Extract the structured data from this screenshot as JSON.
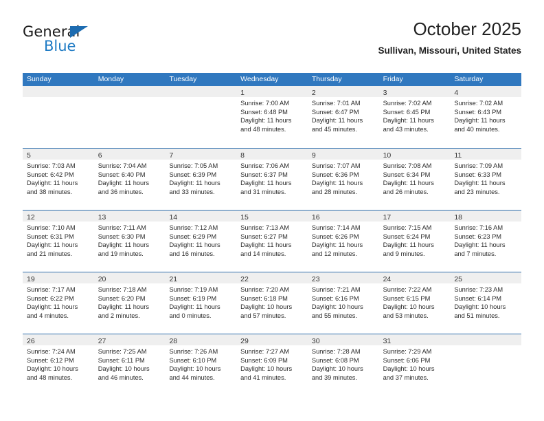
{
  "branding": {
    "logo_text_primary": "General",
    "logo_text_secondary": "Blue",
    "logo_triangle_color": "#1d6cb1",
    "logo_secondary_color": "#1d7ac4"
  },
  "header": {
    "title": "October 2025",
    "subtitle": "Sullivan, Missouri, United States"
  },
  "theme": {
    "header_bar_color": "#3078bf",
    "row_divider_color": "#2f6fad",
    "day_band_color": "#efefef",
    "text_color": "#2a2a2a"
  },
  "weekdays": [
    "Sunday",
    "Monday",
    "Tuesday",
    "Wednesday",
    "Thursday",
    "Friday",
    "Saturday"
  ],
  "labels": {
    "sunrise_prefix": "Sunrise:",
    "sunset_prefix": "Sunset:",
    "daylight_prefix": "Daylight:"
  },
  "weeks": [
    [
      {
        "date": "",
        "empty": true
      },
      {
        "date": "",
        "empty": true
      },
      {
        "date": "",
        "empty": true
      },
      {
        "date": "1",
        "sunrise": "Sunrise: 7:00 AM",
        "sunset": "Sunset: 6:48 PM",
        "daylight": "Daylight: 11 hours and 48 minutes."
      },
      {
        "date": "2",
        "sunrise": "Sunrise: 7:01 AM",
        "sunset": "Sunset: 6:47 PM",
        "daylight": "Daylight: 11 hours and 45 minutes."
      },
      {
        "date": "3",
        "sunrise": "Sunrise: 7:02 AM",
        "sunset": "Sunset: 6:45 PM",
        "daylight": "Daylight: 11 hours and 43 minutes."
      },
      {
        "date": "4",
        "sunrise": "Sunrise: 7:02 AM",
        "sunset": "Sunset: 6:43 PM",
        "daylight": "Daylight: 11 hours and 40 minutes."
      }
    ],
    [
      {
        "date": "5",
        "sunrise": "Sunrise: 7:03 AM",
        "sunset": "Sunset: 6:42 PM",
        "daylight": "Daylight: 11 hours and 38 minutes."
      },
      {
        "date": "6",
        "sunrise": "Sunrise: 7:04 AM",
        "sunset": "Sunset: 6:40 PM",
        "daylight": "Daylight: 11 hours and 36 minutes."
      },
      {
        "date": "7",
        "sunrise": "Sunrise: 7:05 AM",
        "sunset": "Sunset: 6:39 PM",
        "daylight": "Daylight: 11 hours and 33 minutes."
      },
      {
        "date": "8",
        "sunrise": "Sunrise: 7:06 AM",
        "sunset": "Sunset: 6:37 PM",
        "daylight": "Daylight: 11 hours and 31 minutes."
      },
      {
        "date": "9",
        "sunrise": "Sunrise: 7:07 AM",
        "sunset": "Sunset: 6:36 PM",
        "daylight": "Daylight: 11 hours and 28 minutes."
      },
      {
        "date": "10",
        "sunrise": "Sunrise: 7:08 AM",
        "sunset": "Sunset: 6:34 PM",
        "daylight": "Daylight: 11 hours and 26 minutes."
      },
      {
        "date": "11",
        "sunrise": "Sunrise: 7:09 AM",
        "sunset": "Sunset: 6:33 PM",
        "daylight": "Daylight: 11 hours and 23 minutes."
      }
    ],
    [
      {
        "date": "12",
        "sunrise": "Sunrise: 7:10 AM",
        "sunset": "Sunset: 6:31 PM",
        "daylight": "Daylight: 11 hours and 21 minutes."
      },
      {
        "date": "13",
        "sunrise": "Sunrise: 7:11 AM",
        "sunset": "Sunset: 6:30 PM",
        "daylight": "Daylight: 11 hours and 19 minutes."
      },
      {
        "date": "14",
        "sunrise": "Sunrise: 7:12 AM",
        "sunset": "Sunset: 6:29 PM",
        "daylight": "Daylight: 11 hours and 16 minutes."
      },
      {
        "date": "15",
        "sunrise": "Sunrise: 7:13 AM",
        "sunset": "Sunset: 6:27 PM",
        "daylight": "Daylight: 11 hours and 14 minutes."
      },
      {
        "date": "16",
        "sunrise": "Sunrise: 7:14 AM",
        "sunset": "Sunset: 6:26 PM",
        "daylight": "Daylight: 11 hours and 12 minutes."
      },
      {
        "date": "17",
        "sunrise": "Sunrise: 7:15 AM",
        "sunset": "Sunset: 6:24 PM",
        "daylight": "Daylight: 11 hours and 9 minutes."
      },
      {
        "date": "18",
        "sunrise": "Sunrise: 7:16 AM",
        "sunset": "Sunset: 6:23 PM",
        "daylight": "Daylight: 11 hours and 7 minutes."
      }
    ],
    [
      {
        "date": "19",
        "sunrise": "Sunrise: 7:17 AM",
        "sunset": "Sunset: 6:22 PM",
        "daylight": "Daylight: 11 hours and 4 minutes."
      },
      {
        "date": "20",
        "sunrise": "Sunrise: 7:18 AM",
        "sunset": "Sunset: 6:20 PM",
        "daylight": "Daylight: 11 hours and 2 minutes."
      },
      {
        "date": "21",
        "sunrise": "Sunrise: 7:19 AM",
        "sunset": "Sunset: 6:19 PM",
        "daylight": "Daylight: 11 hours and 0 minutes."
      },
      {
        "date": "22",
        "sunrise": "Sunrise: 7:20 AM",
        "sunset": "Sunset: 6:18 PM",
        "daylight": "Daylight: 10 hours and 57 minutes."
      },
      {
        "date": "23",
        "sunrise": "Sunrise: 7:21 AM",
        "sunset": "Sunset: 6:16 PM",
        "daylight": "Daylight: 10 hours and 55 minutes."
      },
      {
        "date": "24",
        "sunrise": "Sunrise: 7:22 AM",
        "sunset": "Sunset: 6:15 PM",
        "daylight": "Daylight: 10 hours and 53 minutes."
      },
      {
        "date": "25",
        "sunrise": "Sunrise: 7:23 AM",
        "sunset": "Sunset: 6:14 PM",
        "daylight": "Daylight: 10 hours and 51 minutes."
      }
    ],
    [
      {
        "date": "26",
        "sunrise": "Sunrise: 7:24 AM",
        "sunset": "Sunset: 6:12 PM",
        "daylight": "Daylight: 10 hours and 48 minutes."
      },
      {
        "date": "27",
        "sunrise": "Sunrise: 7:25 AM",
        "sunset": "Sunset: 6:11 PM",
        "daylight": "Daylight: 10 hours and 46 minutes."
      },
      {
        "date": "28",
        "sunrise": "Sunrise: 7:26 AM",
        "sunset": "Sunset: 6:10 PM",
        "daylight": "Daylight: 10 hours and 44 minutes."
      },
      {
        "date": "29",
        "sunrise": "Sunrise: 7:27 AM",
        "sunset": "Sunset: 6:09 PM",
        "daylight": "Daylight: 10 hours and 41 minutes."
      },
      {
        "date": "30",
        "sunrise": "Sunrise: 7:28 AM",
        "sunset": "Sunset: 6:08 PM",
        "daylight": "Daylight: 10 hours and 39 minutes."
      },
      {
        "date": "31",
        "sunrise": "Sunrise: 7:29 AM",
        "sunset": "Sunset: 6:06 PM",
        "daylight": "Daylight: 10 hours and 37 minutes."
      },
      {
        "date": "",
        "empty": true
      }
    ]
  ]
}
